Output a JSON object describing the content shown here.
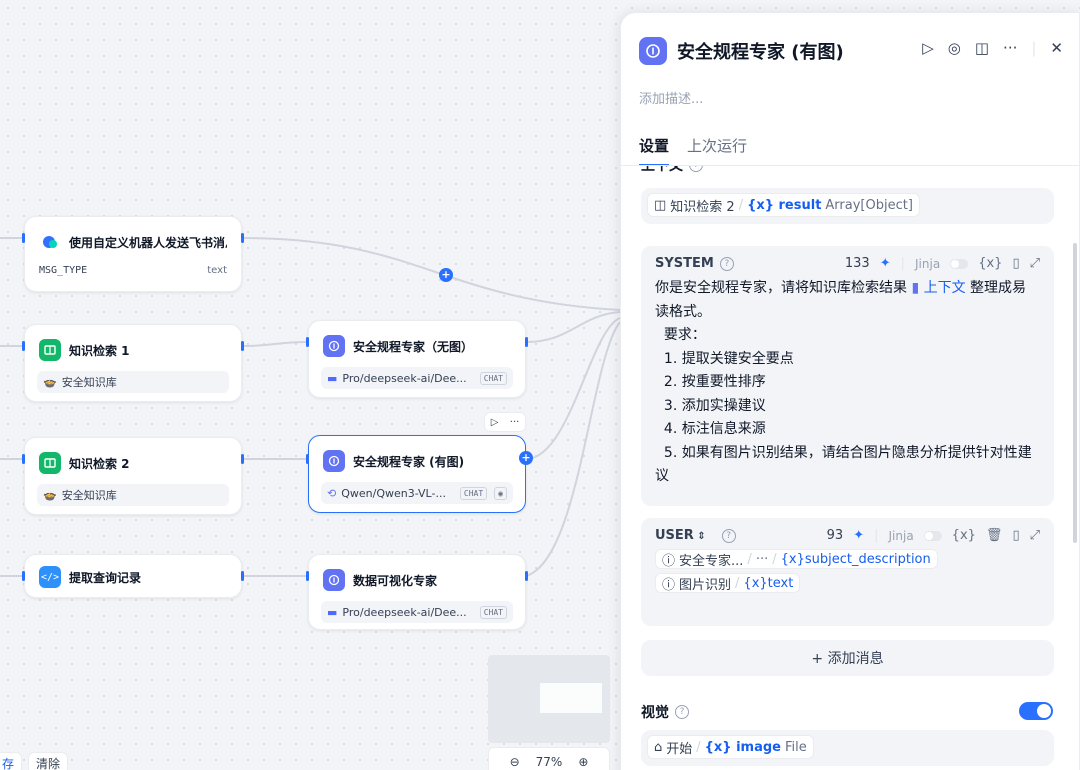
{
  "canvas": {
    "nodes": {
      "bot": {
        "title": "使用自定义机器人发送飞书消息",
        "var_name": "MSG_TYPE",
        "var_type": "text"
      },
      "kn1": {
        "title": "知识检索 1",
        "dataset": "安全知识库"
      },
      "kn2": {
        "title": "知识检索 2",
        "dataset": "安全知识库"
      },
      "code": {
        "title": "提取查询记录"
      },
      "llm1": {
        "title": "安全规程专家（无图）",
        "model": "Pro/deepseek-ai/Dee...",
        "mode": "CHAT"
      },
      "llm2": {
        "title": "安全规程专家 (有图)",
        "model": "Qwen/Qwen3-VL-...",
        "mode": "CHAT"
      },
      "llm3": {
        "title": "数据可视化专家",
        "model": "Pro/deepseek-ai/Dee...",
        "mode": "CHAT"
      }
    },
    "bottom_left": {
      "save": "存",
      "clear": "清除"
    },
    "zoom": {
      "minus": "⊖",
      "value": "77%",
      "plus": "⊕"
    }
  },
  "panel": {
    "title": "安全规程专家 (有图)",
    "description_placeholder": "添加描述...",
    "tabs": [
      {
        "label": "设置"
      },
      {
        "label": "上次运行"
      }
    ],
    "context": {
      "label": "上下文",
      "node": "知识检索 2",
      "var": "{x} result",
      "type": "Array[Object]"
    },
    "system": {
      "label": "SYSTEM",
      "tokens": "133",
      "jinja": "Jinja",
      "ctx_tag": "上下文",
      "text_a": "你是安全规程专家，请将知识库检索结果 ",
      "text_b": " 整理成易读格式。\n  要求：\n  1. 提取关键安全要点\n  2. 按重要性排序\n  3. 添加实操建议\n  4. 标注信息来源\n  5. 如果有图片识别结果，请结合图片隐患分析提供针对性建议"
    },
    "user": {
      "label": "USER",
      "tokens": "93",
      "jinja": "Jinja",
      "pill1_node": "安全专家...",
      "pill1_mid": "···",
      "pill1_var": "{x}subject_description",
      "pill2_node": "图片识别",
      "pill2_var": "{x}text"
    },
    "add_message": "+ 添加消息",
    "vision": {
      "label": "视觉",
      "enabled": true,
      "node": "开始",
      "var": "{x} image",
      "type": "File"
    }
  }
}
